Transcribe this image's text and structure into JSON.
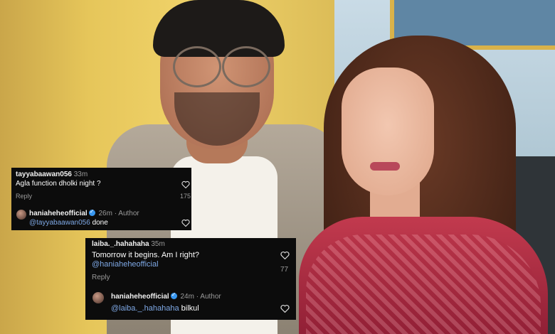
{
  "card1": {
    "comment": {
      "username": "tayyabaawan056",
      "time": "33m",
      "text": "Agla function dholki night ?",
      "reply_label": "Reply",
      "like_count": "175",
      "heart_icon": "heart-outline-icon"
    },
    "reply": {
      "username": "haniaheheofficial",
      "verified_icon": "verified-badge-icon",
      "time": "26m",
      "author_label": "Author",
      "mention": "@tayyabaawan056",
      "text": "done",
      "heart_icon": "heart-outline-icon"
    }
  },
  "card2": {
    "comment": {
      "username": "laiba._.hahahaha",
      "time": "35m",
      "text": "Tomorrow it begins. Am I right?",
      "mention_line": "@haniaheheofficial",
      "reply_label": "Reply",
      "like_count": "77",
      "heart_icon": "heart-outline-icon"
    },
    "reply": {
      "username": "haniaheheofficial",
      "verified_icon": "verified-badge-icon",
      "time": "24m",
      "author_label": "Author",
      "mention": "@laiba._.hahahaha",
      "text": "bilkul",
      "heart_icon": "heart-outline-icon"
    }
  },
  "separator": "·",
  "colors": {
    "card_bg": "#0c0c0c",
    "mention": "#7fa9e6",
    "verified": "#3897f0",
    "muted": "#9a9a9a"
  }
}
